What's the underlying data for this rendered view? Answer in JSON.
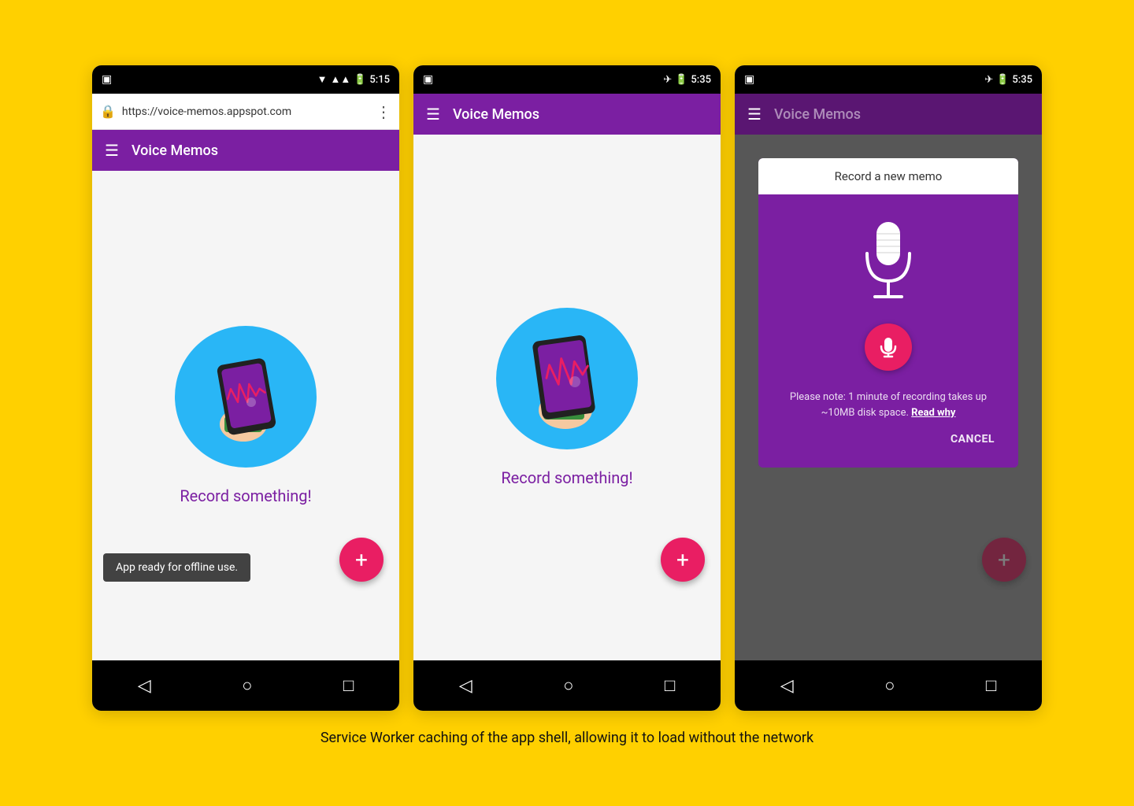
{
  "page": {
    "background": "#FFD000",
    "caption": "Service Worker caching of the app shell, allowing it to load without the network"
  },
  "phone1": {
    "status": {
      "time": "5:15",
      "left_icon": "☐"
    },
    "browser": {
      "url": "https://voice-memos.appspot.com",
      "lock": "🔒"
    },
    "appbar": {
      "title": "Voice Memos"
    },
    "content": {
      "record_text": "Record something!"
    },
    "fab_label": "+",
    "snackbar": "App ready for offline use.",
    "nav": [
      "◁",
      "○",
      "□"
    ]
  },
  "phone2": {
    "status": {
      "time": "5:35"
    },
    "appbar": {
      "title": "Voice Memos"
    },
    "content": {
      "record_text": "Record something!"
    },
    "fab_label": "+",
    "nav": [
      "◁",
      "○",
      "□"
    ]
  },
  "phone3": {
    "status": {
      "time": "5:35"
    },
    "appbar": {
      "title": "Voice Memos"
    },
    "dialog": {
      "title": "Record a new memo",
      "note": "Please note: 1 minute of recording takes up ~10MB disk space.",
      "note_link": "Read why",
      "cancel": "CANCEL"
    },
    "fab_label": "+",
    "nav": [
      "◁",
      "○",
      "□"
    ]
  }
}
